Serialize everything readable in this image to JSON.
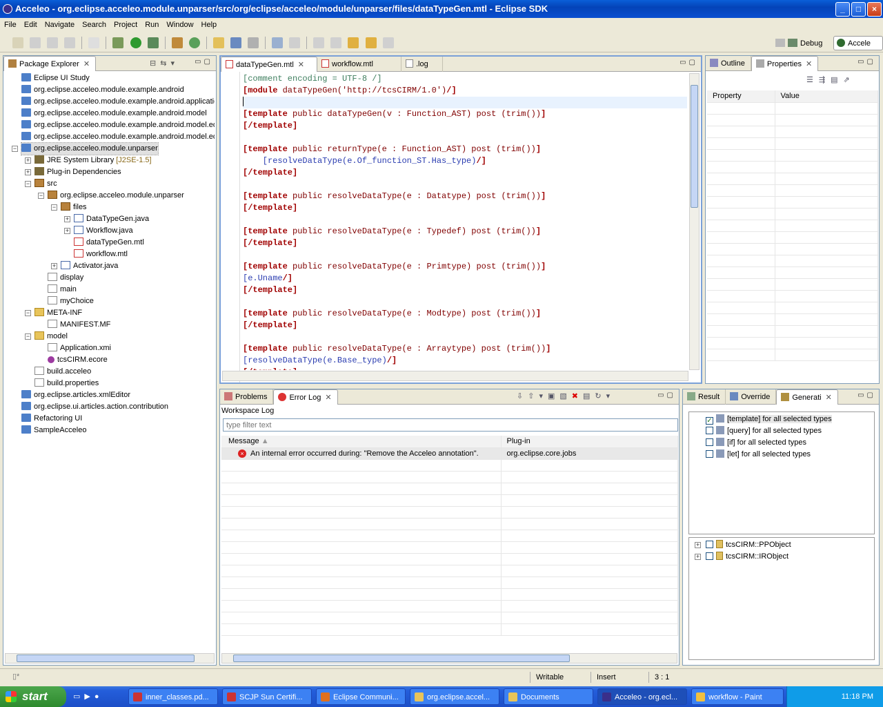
{
  "window": {
    "title": "Acceleo - org.eclipse.acceleo.module.unparser/src/org/eclipse/acceleo/module/unparser/files/dataTypeGen.mtl - Eclipse SDK"
  },
  "menu": [
    "File",
    "Edit",
    "Navigate",
    "Search",
    "Project",
    "Run",
    "Window",
    "Help"
  ],
  "perspectives": {
    "debug": "Debug",
    "acceleo": "Accele"
  },
  "package_explorer": {
    "title": "Package Explorer",
    "rows": [
      {
        "label": "Eclipse UI Study",
        "indent": 0,
        "icon": "project-icon",
        "exp": ""
      },
      {
        "label": "org.eclipse.acceleo.module.example.android",
        "indent": 0,
        "icon": "project-icon",
        "exp": ""
      },
      {
        "label": "org.eclipse.acceleo.module.example.android.applicatio",
        "indent": 0,
        "icon": "project-icon",
        "exp": ""
      },
      {
        "label": "org.eclipse.acceleo.module.example.android.model",
        "indent": 0,
        "icon": "project-icon",
        "exp": ""
      },
      {
        "label": "org.eclipse.acceleo.module.example.android.model.ed",
        "indent": 0,
        "icon": "project-icon",
        "exp": ""
      },
      {
        "label": "org.eclipse.acceleo.module.example.android.model.ed",
        "indent": 0,
        "icon": "project-icon",
        "exp": ""
      },
      {
        "label": "org.eclipse.acceleo.module.unparser",
        "indent": 0,
        "icon": "project-icon",
        "exp": "-",
        "selected": true
      },
      {
        "label": "JRE System Library",
        "suffix": "[J2SE-1.5]",
        "indent": 1,
        "icon": "library-icon",
        "exp": "+"
      },
      {
        "label": "Plug-in Dependencies",
        "indent": 1,
        "icon": "library-icon",
        "exp": "+"
      },
      {
        "label": "src",
        "indent": 1,
        "icon": "source-folder-icon",
        "exp": "-"
      },
      {
        "label": "org.eclipse.acceleo.module.unparser",
        "indent": 2,
        "icon": "package-icon",
        "exp": "-"
      },
      {
        "label": "files",
        "indent": 3,
        "icon": "package-icon",
        "exp": "-"
      },
      {
        "label": "DataTypeGen.java",
        "indent": 4,
        "icon": "java-file-icon",
        "exp": "+"
      },
      {
        "label": "Workflow.java",
        "indent": 4,
        "icon": "java-file-icon",
        "exp": "+"
      },
      {
        "label": "dataTypeGen.mtl",
        "indent": 4,
        "icon": "mtl-file-icon",
        "exp": ""
      },
      {
        "label": "workflow.mtl",
        "indent": 4,
        "icon": "mtl-file-icon",
        "exp": ""
      },
      {
        "label": "Activator.java",
        "indent": 3,
        "icon": "java-file-icon",
        "exp": "+"
      },
      {
        "label": "display",
        "indent": 2,
        "icon": "file-icon",
        "exp": ""
      },
      {
        "label": "main",
        "indent": 2,
        "icon": "file-icon",
        "exp": ""
      },
      {
        "label": "myChoice",
        "indent": 2,
        "icon": "file-icon",
        "exp": ""
      },
      {
        "label": "META-INF",
        "indent": 1,
        "icon": "folder-icon",
        "exp": "-"
      },
      {
        "label": "MANIFEST.MF",
        "indent": 2,
        "icon": "file-icon",
        "exp": ""
      },
      {
        "label": "model",
        "indent": 1,
        "icon": "folder-icon",
        "exp": "-"
      },
      {
        "label": "Application.xmi",
        "indent": 2,
        "icon": "file-icon",
        "exp": ""
      },
      {
        "label": "tcsCIRM.ecore",
        "indent": 2,
        "icon": "ecore-icon",
        "exp": ""
      },
      {
        "label": "build.acceleo",
        "indent": 1,
        "icon": "file-icon",
        "exp": ""
      },
      {
        "label": "build.properties",
        "indent": 1,
        "icon": "file-icon",
        "exp": ""
      },
      {
        "label": "org.eclipse.articles.xmlEditor",
        "indent": 0,
        "icon": "project-icon",
        "exp": ""
      },
      {
        "label": "org.eclipse.ui.articles.action.contribution",
        "indent": 0,
        "icon": "project-icon",
        "exp": ""
      },
      {
        "label": "Refactoring UI",
        "indent": 0,
        "icon": "project-icon",
        "exp": ""
      },
      {
        "label": "SampleAcceleo",
        "indent": 0,
        "icon": "project-icon",
        "exp": ""
      }
    ]
  },
  "editor": {
    "tabs": [
      "dataTypeGen.mtl",
      "workflow.mtl",
      ".log"
    ],
    "lines": [
      [
        {
          "t": "[comment encoding = UTF-8 /]",
          "c": "cm"
        }
      ],
      [
        {
          "t": "[module ",
          "c": "kw"
        },
        {
          "t": "dataTypeGen('http://tcsCIRM/1.0')",
          "c": "tx"
        },
        {
          "t": "/]",
          "c": "kw"
        }
      ],
      [
        {
          "t": "",
          "c": "tx"
        }
      ],
      [
        {
          "t": "[template ",
          "c": "kw"
        },
        {
          "t": "public dataTypeGen(v : Function_AST) post (trim())",
          "c": "tx"
        },
        {
          "t": "]",
          "c": "kw"
        }
      ],
      [
        {
          "t": "[/template]",
          "c": "kw"
        }
      ],
      [
        {
          "t": "",
          "c": "tx"
        }
      ],
      [
        {
          "t": "[template ",
          "c": "kw"
        },
        {
          "t": "public returnType(e : Function_AST) post (trim())",
          "c": "tx"
        },
        {
          "t": "]",
          "c": "kw"
        }
      ],
      [
        {
          "t": "    [resolveDataType(e.Of_function_ST.Has_type)",
          "c": "bl"
        },
        {
          "t": "/]",
          "c": "kw"
        }
      ],
      [
        {
          "t": "[/template]",
          "c": "kw"
        }
      ],
      [
        {
          "t": "",
          "c": "tx"
        }
      ],
      [
        {
          "t": "[template ",
          "c": "kw"
        },
        {
          "t": "public resolveDataType(e : Datatype) post (trim())",
          "c": "tx"
        },
        {
          "t": "]",
          "c": "kw"
        }
      ],
      [
        {
          "t": "[/template]",
          "c": "kw"
        }
      ],
      [
        {
          "t": "",
          "c": "tx"
        }
      ],
      [
        {
          "t": "[template ",
          "c": "kw"
        },
        {
          "t": "public resolveDataType(e : Typedef) post (trim())",
          "c": "tx"
        },
        {
          "t": "]",
          "c": "kw"
        }
      ],
      [
        {
          "t": "[/template]",
          "c": "kw"
        }
      ],
      [
        {
          "t": "",
          "c": "tx"
        }
      ],
      [
        {
          "t": "[template ",
          "c": "kw"
        },
        {
          "t": "public resolveDataType(e : Primtype) post (trim())",
          "c": "tx"
        },
        {
          "t": "]",
          "c": "kw"
        }
      ],
      [
        {
          "t": "[e.Uname",
          "c": "bl"
        },
        {
          "t": "/]",
          "c": "kw"
        }
      ],
      [
        {
          "t": "[/template]",
          "c": "kw"
        }
      ],
      [
        {
          "t": "",
          "c": "tx"
        }
      ],
      [
        {
          "t": "[template ",
          "c": "kw"
        },
        {
          "t": "public resolveDataType(e : Modtype) post (trim())",
          "c": "tx"
        },
        {
          "t": "]",
          "c": "kw"
        }
      ],
      [
        {
          "t": "[/template]",
          "c": "kw"
        }
      ],
      [
        {
          "t": "",
          "c": "tx"
        }
      ],
      [
        {
          "t": "[template ",
          "c": "kw"
        },
        {
          "t": "public resolveDataType(e : Arraytype) post (trim())",
          "c": "tx"
        },
        {
          "t": "]",
          "c": "kw"
        }
      ],
      [
        {
          "t": "[resolveDataType(e.Base_type)",
          "c": "bl"
        },
        {
          "t": "/]",
          "c": "kw"
        }
      ],
      [
        {
          "t": "[/template]",
          "c": "kw"
        }
      ]
    ]
  },
  "outline": {
    "tabs": [
      "Outline",
      "Properties"
    ],
    "columns": [
      "Property",
      "Value"
    ]
  },
  "error_log": {
    "tabs": [
      "Problems",
      "Error Log"
    ],
    "workspace_label": "Workspace Log",
    "filter_placeholder": "type filter text",
    "columns": [
      "Message",
      "Plug-in"
    ],
    "rows": [
      {
        "message": "An internal error occurred during: \"Remove the Acceleo annotation\".",
        "plugin": "org.eclipse.core.jobs"
      }
    ]
  },
  "generation": {
    "tabs": [
      "Result",
      "Override",
      "Generati"
    ],
    "items": [
      {
        "label": "[template] for all selected types",
        "checked": true,
        "selected": true
      },
      {
        "label": "[query] for all selected types",
        "checked": false
      },
      {
        "label": "[if] for all selected types",
        "checked": false
      },
      {
        "label": "[let] for all selected types",
        "checked": false
      }
    ],
    "types": [
      "tcsCIRM::PPObject",
      "tcsCIRM::IRObject"
    ]
  },
  "status": {
    "writable": "Writable",
    "insert": "Insert",
    "position": "3 : 1"
  },
  "taskbar": {
    "start": "start",
    "tasks": [
      "inner_classes.pd...",
      "SCJP Sun Certifi...",
      "Eclipse Communi...",
      "org.eclipse.accel...",
      "Documents",
      "Acceleo - org.ecl...",
      "workflow - Paint"
    ],
    "clock": "11:18 PM"
  }
}
